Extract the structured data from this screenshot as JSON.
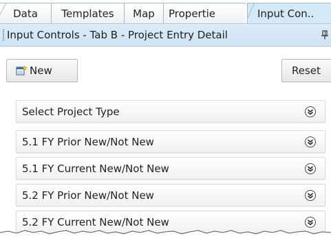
{
  "tabs": [
    {
      "label": "Data"
    },
    {
      "label": "Templates"
    },
    {
      "label": "Map"
    },
    {
      "label": "Propertie"
    },
    {
      "label": "Input Con.."
    }
  ],
  "panel": {
    "title": "Input Controls - Tab B - Project Entry Detail",
    "pin_icon": "pin-icon"
  },
  "toolbar": {
    "new_label": "New",
    "new_icon": "new-document-icon",
    "reset_label": "Reset"
  },
  "list": {
    "items": [
      {
        "label": "Select Project Type"
      },
      {
        "label": "5.1 FY Prior New/Not New"
      },
      {
        "label": "5.1 FY Current New/Not New"
      },
      {
        "label": "5.2 FY Prior New/Not New"
      },
      {
        "label": "5.2 FY Current New/Not New"
      }
    ],
    "expand_icon": "expand-chevron-icon"
  },
  "colors": {
    "active_tab": "#d4e8f6",
    "panel_header": "#d6e8f6",
    "border": "#aab3c0"
  }
}
